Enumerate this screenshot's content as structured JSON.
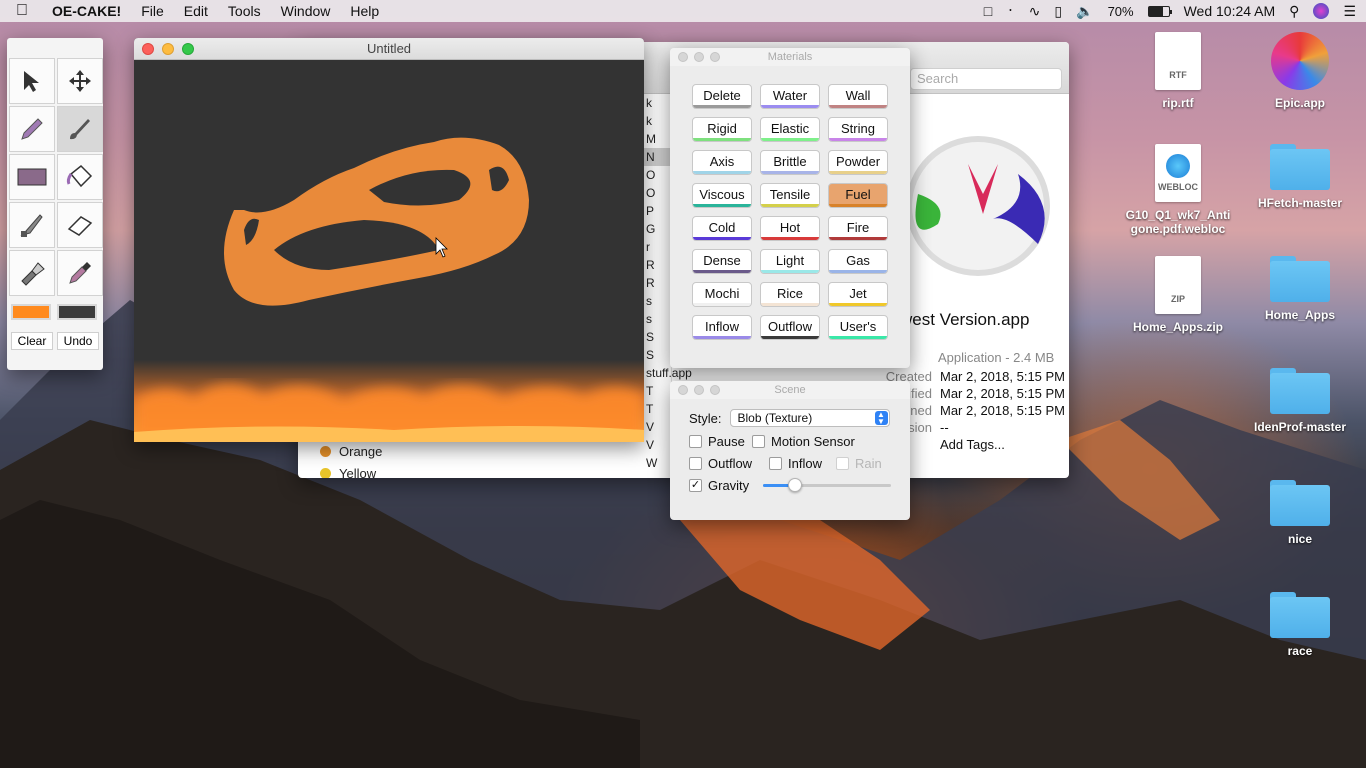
{
  "menubar": {
    "app_name": "OE-CAKE!",
    "menus": [
      "File",
      "Edit",
      "Tools",
      "Window",
      "Help"
    ],
    "battery": "70%",
    "battery_level": 0.7,
    "clock": "Wed 10:24 AM"
  },
  "tools_palette": {
    "tools": [
      "select-tool",
      "move-tool",
      "pencil-tool",
      "brush-tool",
      "rectangle-tool",
      "fill-bucket-tool",
      "knife-tool",
      "eraser-tool",
      "flashlight-tool",
      "eyedropper-tool"
    ],
    "active_tool": "brush-tool",
    "primary_color": "#ff8a1e",
    "secondary_color": "#3c3c3c",
    "clear_label": "Clear",
    "undo_label": "Undo"
  },
  "canvas_window": {
    "title": "Untitled"
  },
  "finder": {
    "search_placeholder": "Search",
    "list_initials": [
      "k",
      "k",
      "M",
      "N",
      "O",
      "O",
      "P",
      "G",
      "r",
      "R",
      "R",
      "s",
      "s",
      "S",
      "S",
      "stuff.app",
      "T",
      "T",
      "V",
      "V",
      "W"
    ],
    "tags": [
      {
        "name": "Orange",
        "color": "#e5902a"
      },
      {
        "name": "Yellow",
        "color": "#e8c42a"
      }
    ],
    "app_name_partial": "west Version.app",
    "type_size": "Application - 2.4 MB",
    "info": [
      {
        "label": "Created",
        "value": "Mar 2, 2018, 5:15 PM"
      },
      {
        "label": "ified",
        "value": "Mar 2, 2018, 5:15 PM"
      },
      {
        "label": "ned",
        "value": "Mar 2, 2018, 5:15 PM"
      },
      {
        "label": "sion",
        "value": "--"
      }
    ],
    "add_tags": "Add Tags..."
  },
  "materials": {
    "title": "Materials",
    "selected": "Fuel",
    "buttons": [
      {
        "label": "Delete",
        "color": "#9a9a9a"
      },
      {
        "label": "Water",
        "color": "#9b8cf0"
      },
      {
        "label": "Wall",
        "color": "#c08383"
      },
      {
        "label": "Rigid",
        "color": "#7ee07e"
      },
      {
        "label": "Elastic",
        "color": "#7ef08a"
      },
      {
        "label": "String",
        "color": "#c884e8"
      },
      {
        "label": "Axis",
        "color": "#a0d4e8"
      },
      {
        "label": "Brittle",
        "color": "#a8b4e8"
      },
      {
        "label": "Powder",
        "color": "#e8d08a"
      },
      {
        "label": "Viscous",
        "color": "#2ab49a"
      },
      {
        "label": "Tensile",
        "color": "#d4d04a"
      },
      {
        "label": "Fuel",
        "color": "#d8822a"
      },
      {
        "label": "Cold",
        "color": "#5a3ad8"
      },
      {
        "label": "Hot",
        "color": "#d83a3a"
      },
      {
        "label": "Fire",
        "color": "#b03a3a"
      },
      {
        "label": "Dense",
        "color": "#6a5a8a"
      },
      {
        "label": "Light",
        "color": "#9ae8e8"
      },
      {
        "label": "Gas",
        "color": "#9ab4e8"
      },
      {
        "label": "Mochi",
        "color": "#f0f0f0"
      },
      {
        "label": "Rice",
        "color": "#f4e4d4"
      },
      {
        "label": "Jet",
        "color": "#f0c82a"
      },
      {
        "label": "Inflow",
        "color": "#9a8ae8"
      },
      {
        "label": "Outflow",
        "color": "#3a3a3a"
      },
      {
        "label": "User's",
        "color": "#3ae8a8"
      }
    ]
  },
  "scene": {
    "title": "Scene",
    "style_label": "Style:",
    "style_value": "Blob (Texture)",
    "pause_label": "Pause",
    "motion_sensor_label": "Motion Sensor",
    "outflow_label": "Outflow",
    "inflow_label": "Inflow",
    "rain_label": "Rain",
    "gravity_label": "Gravity",
    "gravity_checked": true,
    "gravity_level": 0.22
  },
  "desktop": {
    "icons": [
      {
        "name": "rip.rtf",
        "kind": "doc",
        "tag": "RTF"
      },
      {
        "name": "Epic.app",
        "kind": "app"
      },
      {
        "name": "G10_Q1_wk7_Antigone.pdf.webloc",
        "kind": "webloc",
        "tag": "WEBLOC"
      },
      {
        "name": "HFetch-master",
        "kind": "folder"
      },
      {
        "name": "Home_Apps.zip",
        "kind": "zip",
        "tag": "ZIP"
      },
      {
        "name": "Home_Apps",
        "kind": "folder"
      },
      {
        "name": "IdenProf-master",
        "kind": "folder"
      },
      {
        "name": "nice",
        "kind": "folder"
      },
      {
        "name": "race",
        "kind": "folder"
      }
    ]
  }
}
